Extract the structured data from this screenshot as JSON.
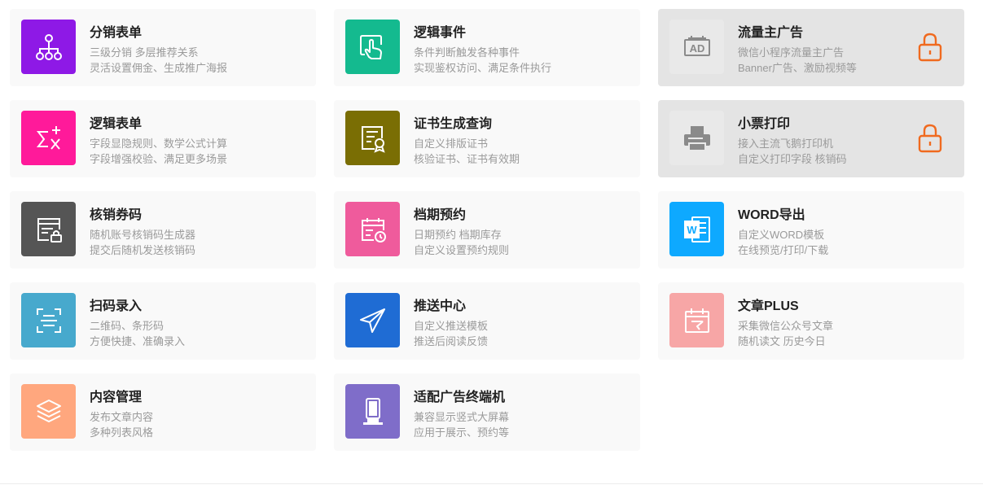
{
  "colors": {
    "distribution": "#8e19e6",
    "logic_form": "#ff1a9a",
    "coupon": "#555555",
    "scan": "#47a9cd",
    "content": "#ffa77e",
    "logic_event": "#14ba8f",
    "certificate": "#7a6e04",
    "schedule": "#ef5b9c",
    "push": "#1f6cd4",
    "ad_terminal": "#7f6dc9",
    "locked_tile": "#e9e9e9",
    "locked_icon": "#8a8a8a",
    "lock": "#f06a1f",
    "word": "#0ea9ff",
    "article": "#f7a6a6"
  },
  "features": [
    {
      "key": "distribution",
      "icon": "network-tree-icon",
      "title": "分销表单",
      "line1": "三级分销 多层推荐关系",
      "line2": "灵活设置佣金、生成推广海报"
    },
    {
      "key": "logic_event",
      "icon": "tap-hand-icon",
      "title": "逻辑事件",
      "line1": "条件判断触发各种事件",
      "line2": "实现鉴权访问、满足条件执行"
    },
    {
      "key": "traffic_ads",
      "icon": "ad-icon",
      "title": "流量主广告",
      "line1": "微信小程序流量主广告",
      "line2": "Banner广告、激励视频等",
      "locked": true
    },
    {
      "key": "logic_form",
      "icon": "formula-icon",
      "title": "逻辑表单",
      "line1": "字段显隐规则、数学公式计算",
      "line2": "字段增强校验、满足更多场景"
    },
    {
      "key": "certificate",
      "icon": "certificate-icon",
      "title": "证书生成查询",
      "line1": "自定义排版证书",
      "line2": "核验证书、证书有效期"
    },
    {
      "key": "receipt_print",
      "icon": "printer-icon",
      "title": "小票打印",
      "line1": "接入主流飞鹅打印机",
      "line2": "自定义打印字段 核销码",
      "locked": true
    },
    {
      "key": "coupon",
      "icon": "coupon-lock-icon",
      "title": "核销券码",
      "line1": "随机账号核销码生成器",
      "line2": "提交后随机发送核销码"
    },
    {
      "key": "schedule",
      "icon": "calendar-clock-icon",
      "title": "档期预约",
      "line1": "日期预约 档期库存",
      "line2": "自定义设置预约规则"
    },
    {
      "key": "word",
      "icon": "word-doc-icon",
      "title": "WORD导出",
      "line1": "自定义WORD模板",
      "line2": "在线预览/打印/下载"
    },
    {
      "key": "scan",
      "icon": "scan-icon",
      "title": "扫码录入",
      "line1": "二维码、条形码",
      "line2": "方便快捷、准确录入"
    },
    {
      "key": "push",
      "icon": "paper-plane-icon",
      "title": "推送中心",
      "line1": "自定义推送模板",
      "line2": "推送后阅读反馈"
    },
    {
      "key": "article",
      "icon": "article-calendar-icon",
      "title": "文章PLUS",
      "line1": "采集微信公众号文章",
      "line2": "随机读文 历史今日"
    },
    {
      "key": "content",
      "icon": "layers-icon",
      "title": "内容管理",
      "line1": "发布文章内容",
      "line2": "多种列表风格"
    },
    {
      "key": "ad_terminal",
      "icon": "kiosk-icon",
      "title": "适配广告终端机",
      "line1": "兼容显示竖式大屏幕",
      "line2": "应用于展示、预约等"
    }
  ]
}
